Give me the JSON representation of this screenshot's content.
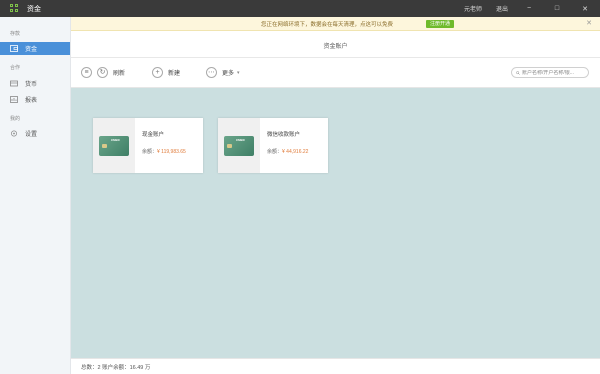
{
  "app": {
    "title": "资金"
  },
  "titlebar": {
    "links": [
      "元老师",
      "退出"
    ],
    "min": "−",
    "max": "□",
    "close": "✕"
  },
  "sidebar": {
    "groups": [
      {
        "label": "存款",
        "items": [
          {
            "label": "资金",
            "icon": "wallet-icon",
            "active": true
          }
        ]
      },
      {
        "label": "合作",
        "items": [
          {
            "label": "货币",
            "icon": "money-icon",
            "active": false
          },
          {
            "label": "报表",
            "icon": "report-icon",
            "active": false
          }
        ]
      },
      {
        "label": "我的",
        "items": [
          {
            "label": "设置",
            "icon": "gear-icon",
            "active": false
          }
        ]
      }
    ]
  },
  "notice": {
    "text": "您正在网络环境下，数据会在每天清理，点这可以免费",
    "button": "注册开通",
    "close": "✕"
  },
  "page": {
    "title": "资金账户"
  },
  "toolbar": {
    "menu_icon": "≡",
    "refresh": "刷新",
    "add": "新建",
    "more": "更多",
    "search_placeholder": "账户名称/开户名称/银..."
  },
  "accounts": [
    {
      "name": "现金账户",
      "balance_label": "余额：",
      "balance": "¥ 119,983.65"
    },
    {
      "name": "微信收款账户",
      "balance_label": "余额：",
      "balance": "¥ 44,916.22"
    }
  ],
  "card_brand": "CMBC",
  "status": {
    "text": "总数：2    账户余额：16.49 万"
  }
}
